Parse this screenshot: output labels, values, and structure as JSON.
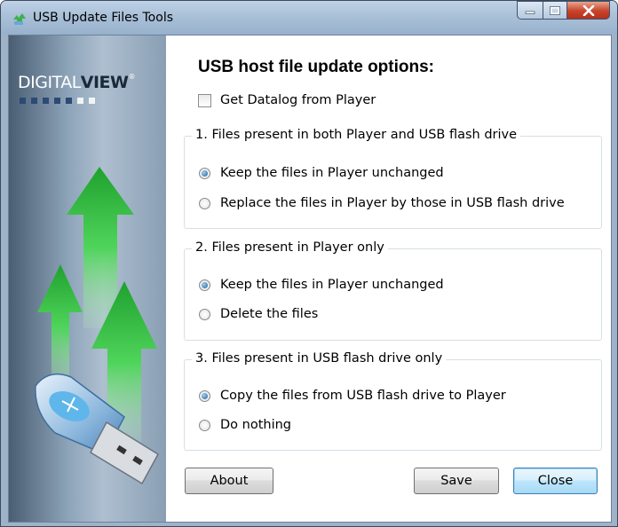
{
  "window": {
    "title": "USB Update Files Tools"
  },
  "brand": {
    "logo_light": "DIGITAL",
    "logo_bold": "VIEW",
    "logo_mark": "®"
  },
  "main": {
    "heading": "USB host file update options:",
    "datalog_label": "Get Datalog from Player",
    "datalog_checked": false,
    "groups": [
      {
        "title": "1. Files present in both Player and USB flash drive",
        "options": [
          {
            "label": "Keep the files in Player unchanged",
            "selected": true
          },
          {
            "label": "Replace the files in Player by those in USB flash drive",
            "selected": false
          }
        ]
      },
      {
        "title": "2. Files present in Player only",
        "options": [
          {
            "label": "Keep the files in Player unchanged",
            "selected": true
          },
          {
            "label": "Delete the files",
            "selected": false
          }
        ]
      },
      {
        "title": "3. Files present in USB flash drive only",
        "options": [
          {
            "label": "Copy the files from USB flash drive to Player",
            "selected": true
          },
          {
            "label": "Do nothing",
            "selected": false
          }
        ]
      }
    ]
  },
  "buttons": {
    "about": "About",
    "save": "Save",
    "close": "Close"
  },
  "colors": {
    "accent": "#3c7fb1",
    "arrow_green": "#3cc24a",
    "close_red": "#c7432a"
  },
  "icons": [
    "app-icon",
    "minimize-icon",
    "maximize-icon",
    "close-icon",
    "green-arrow-icon",
    "usb-drive-icon"
  ]
}
